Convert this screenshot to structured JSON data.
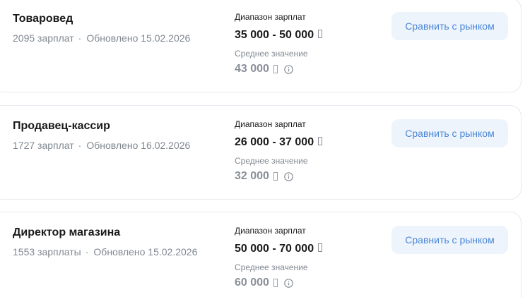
{
  "vacancies": [
    {
      "title": "Товаровед",
      "salary_count": "2095 зарплат",
      "updated": "Обновлено 15.02.2026",
      "range_label": "Диапазон зарплат",
      "range_value": "35 000 - 50 000",
      "avg_label": "Среднее значение",
      "avg_value": "43 000",
      "compare_label": "Сравнить с рынком"
    },
    {
      "title": "Продавец-кассир",
      "salary_count": "1727 зарплат",
      "updated": "Обновлено 16.02.2026",
      "range_label": "Диапазон зарплат",
      "range_value": "26 000 - 37 000",
      "avg_label": "Среднее значение",
      "avg_value": "32 000",
      "compare_label": "Сравнить с рынком"
    },
    {
      "title": "Директор магазина",
      "salary_count": "1553 зарплаты",
      "updated": "Обновлено 15.02.2026",
      "range_label": "Диапазон зарплат",
      "range_value": "50 000 - 70 000",
      "avg_label": "Среднее значение",
      "avg_value": "60 000",
      "compare_label": "Сравнить с рынком"
    }
  ],
  "icons": {
    "currency": "currency-icon",
    "info": "info-icon"
  },
  "colors": {
    "accent": "#4a86d6",
    "button_bg": "#eef4fc",
    "muted_text": "#808891",
    "primary_text": "#1a1a1a"
  }
}
